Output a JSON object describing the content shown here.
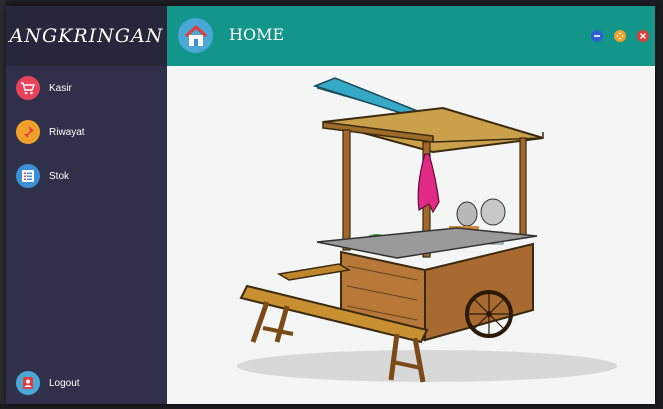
{
  "app": {
    "brand": "ANGKRINGAN"
  },
  "header": {
    "title": "HOME"
  },
  "sidebar": {
    "items": [
      {
        "label": "Kasir",
        "icon": "shopping-cart-icon",
        "color": "#e8435a"
      },
      {
        "label": "Riwayat",
        "icon": "pin-icon",
        "color": "#f1a12b"
      },
      {
        "label": "Stok",
        "icon": "list-icon",
        "color": "#3a8fd6"
      }
    ],
    "logout": {
      "label": "Logout",
      "icon": "logout-icon",
      "color": "#4aa7d6"
    }
  },
  "window_controls": [
    {
      "name": "minimize-button",
      "icon": "minus-icon",
      "color": "#2f5fd0"
    },
    {
      "name": "maximize-button",
      "icon": "move-icon",
      "color": "#f1a12b"
    },
    {
      "name": "close-button",
      "icon": "close-icon",
      "color": "#e23a3a"
    }
  ],
  "colors": {
    "sidebar": "#30304a",
    "brand_bg": "#27273c",
    "header": "#12968a",
    "content_bg": "#f4f5f5"
  },
  "illustration": "angkringan-cart-illustration"
}
